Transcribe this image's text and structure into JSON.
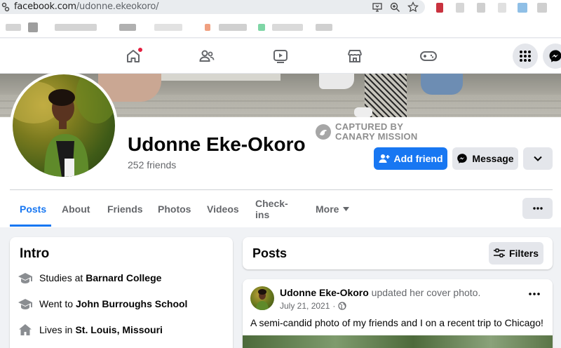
{
  "browser": {
    "url_domain": "facebook.com",
    "url_path": "/udonne.ekeokoro/"
  },
  "profile": {
    "name": "Udonne Eke-Okoro",
    "friends": "252 friends"
  },
  "watermark": {
    "line1": "CAPTURED BY",
    "line2": "CANARY MISSION"
  },
  "actions": {
    "add_friend": "Add friend",
    "message": "Message"
  },
  "tabs": [
    "Posts",
    "About",
    "Friends",
    "Photos",
    "Videos",
    "Check-ins",
    "More"
  ],
  "intro": {
    "title": "Intro",
    "items": [
      {
        "prefix": "Studies at",
        "value": "Barnard College",
        "icon": "graduation-cap-icon"
      },
      {
        "prefix": "Went to",
        "value": "John Burroughs School",
        "icon": "graduation-cap-icon"
      },
      {
        "prefix": "Lives in",
        "value": "St. Louis, Missouri",
        "icon": "home-icon"
      }
    ]
  },
  "posts_section": {
    "title": "Posts",
    "filters_label": "Filters"
  },
  "post": {
    "author": "Udonne Eke-Okoro",
    "action": " updated her cover photo.",
    "date": "July 21, 2021",
    "text": "A semi-candid photo of my friends and I on a recent trip to Chicago!"
  },
  "colors": {
    "brand_blue": "#1877f2",
    "notification_red": "#e41e3f",
    "button_gray": "#e4e6eb",
    "page_bg": "#f0f2f5"
  }
}
